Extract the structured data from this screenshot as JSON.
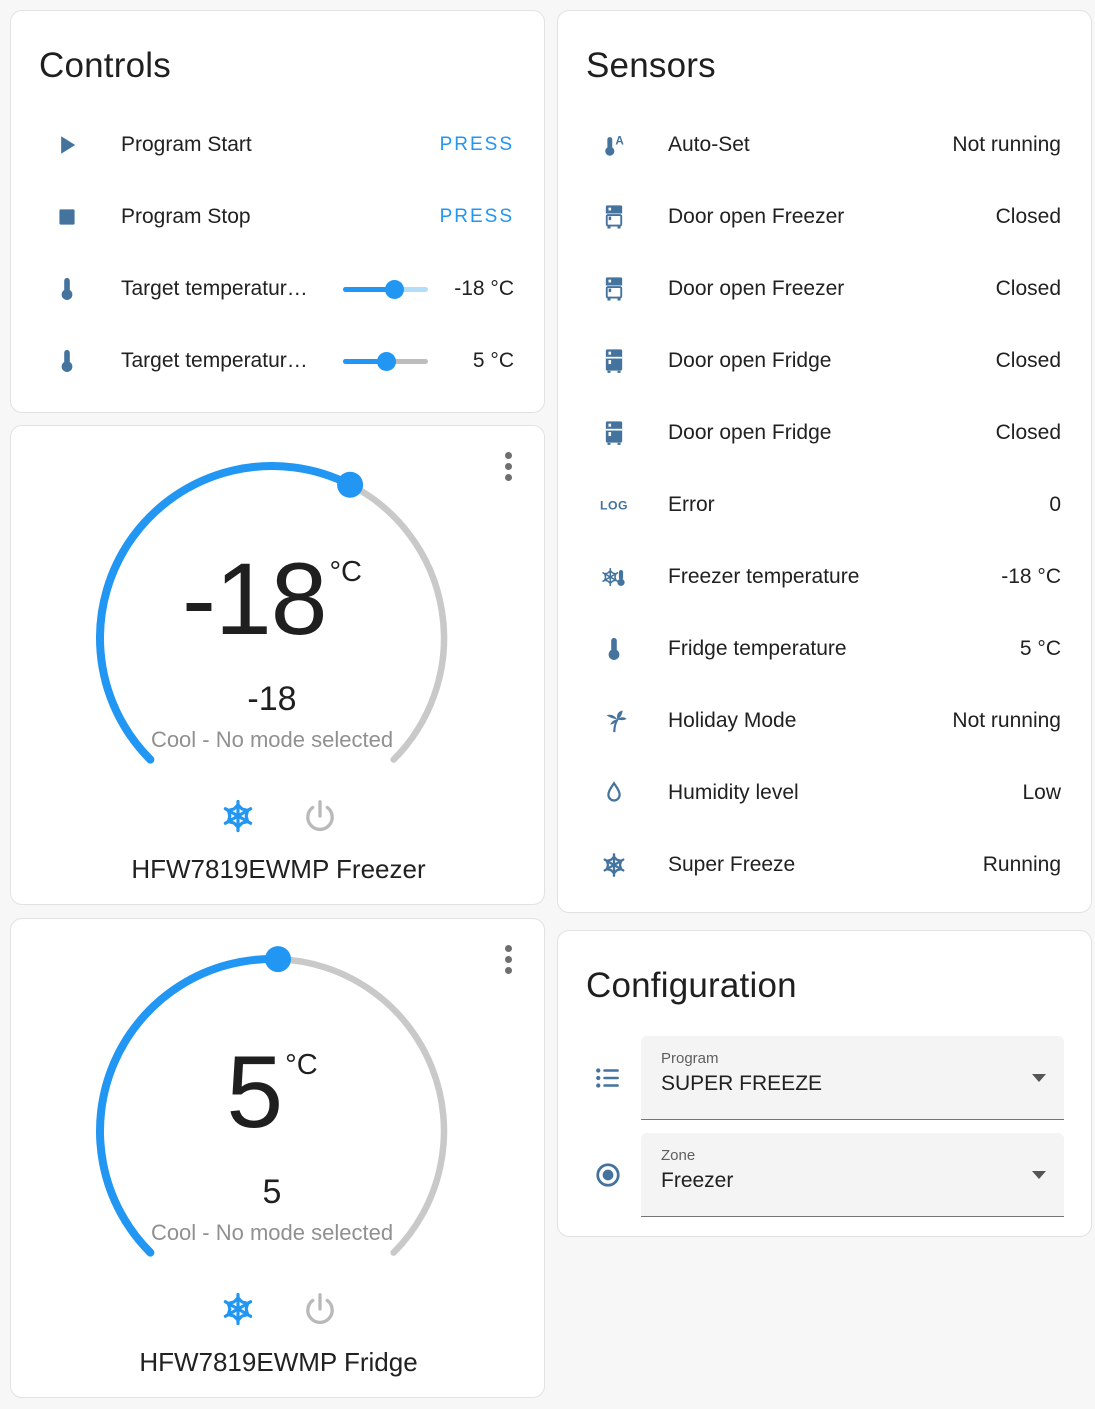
{
  "colors": {
    "accent": "#2196f3",
    "icon": "#44739e",
    "inactive_gray": "#bdbdbd",
    "inactive_blue": "#b3def8"
  },
  "controls": {
    "title": "Controls",
    "rows": [
      {
        "icon": "play-icon",
        "label": "Program Start",
        "type": "button",
        "action": "PRESS"
      },
      {
        "icon": "stop-icon",
        "label": "Program Stop",
        "type": "button",
        "action": "PRESS"
      },
      {
        "icon": "thermometer-icon",
        "label": "Target temperatur…",
        "type": "slider",
        "value": "-18 °C",
        "percent": 61,
        "inactive": "#b3def8"
      },
      {
        "icon": "thermometer-icon",
        "label": "Target temperatur…",
        "type": "slider",
        "value": "5 °C",
        "percent": 51,
        "inactive": "#bdbdbd"
      }
    ]
  },
  "thermostats": [
    {
      "name": "HFW7819EWMP Freezer",
      "temp": "-18",
      "unit": "°C",
      "target": "-18",
      "mode": "Cool - No mode selected",
      "handle_deg": 27
    },
    {
      "name": "HFW7819EWMP Fridge",
      "temp": "5",
      "unit": "°C",
      "target": "5",
      "mode": "Cool - No mode selected",
      "handle_deg": 2
    }
  ],
  "sensors": {
    "title": "Sensors",
    "rows": [
      {
        "icon": "thermometer-auto-icon",
        "label": "Auto-Set",
        "value": "Not running"
      },
      {
        "icon": "fridge-top-icon",
        "label": "Door open Freezer",
        "value": "Closed"
      },
      {
        "icon": "fridge-top-icon",
        "label": "Door open Freezer",
        "value": "Closed"
      },
      {
        "icon": "fridge-bottom-icon",
        "label": "Door open Fridge",
        "value": "Closed"
      },
      {
        "icon": "fridge-bottom-icon",
        "label": "Door open Fridge",
        "value": "Closed"
      },
      {
        "icon": "log-icon",
        "label": "Error",
        "value": "0"
      },
      {
        "icon": "snowflake-thermometer-icon",
        "label": "Freezer temperature",
        "value": "-18 °C"
      },
      {
        "icon": "thermometer-icon",
        "label": "Fridge temperature",
        "value": "5 °C"
      },
      {
        "icon": "palm-tree-icon",
        "label": "Holiday Mode",
        "value": "Not running"
      },
      {
        "icon": "water-drop-icon",
        "label": "Humidity level",
        "value": "Low"
      },
      {
        "icon": "snowflake-icon",
        "label": "Super Freeze",
        "value": "Running"
      }
    ]
  },
  "configuration": {
    "title": "Configuration",
    "fields": [
      {
        "icon": "list-icon",
        "label": "Program",
        "value": "SUPER FREEZE"
      },
      {
        "icon": "radiobox-icon",
        "label": "Zone",
        "value": "Freezer"
      }
    ]
  }
}
